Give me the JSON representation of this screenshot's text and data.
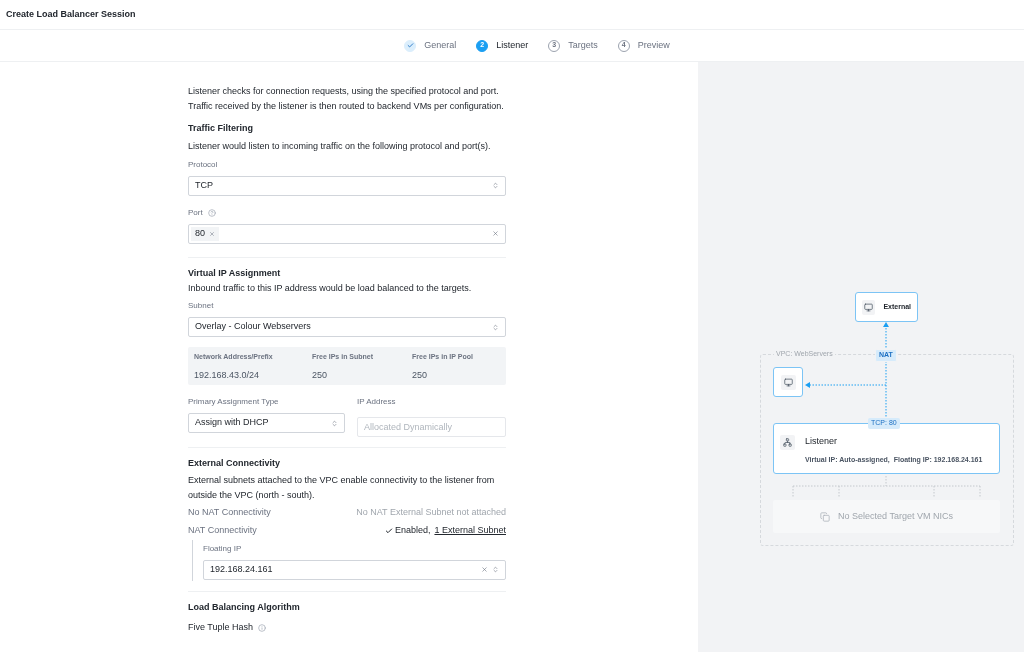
{
  "title": "Create Load Balancer Session",
  "steps": [
    {
      "label": "General",
      "selected": false,
      "completed": true
    },
    {
      "number": "2",
      "label": "Listener",
      "selected": true,
      "completed": false
    },
    {
      "number": "3",
      "label": "Targets",
      "selected": false,
      "completed": false
    },
    {
      "number": "4",
      "label": "Preview",
      "selected": false,
      "completed": false
    }
  ],
  "intro": [
    "Listener checks for connection requests, using the specified protocol and port.",
    "Traffic received by the listener is then routed to backend VMs per configuration."
  ],
  "traffic_filtering": {
    "heading": "Traffic Filtering",
    "description": "Listener would listen to incoming traffic on the following protocol and port(s).",
    "protocol": {
      "label": "Protocol",
      "value": "TCP"
    },
    "port": {
      "label": "Port",
      "tags": [
        "80"
      ]
    }
  },
  "virtual_ip": {
    "heading": "Virtual IP Assignment",
    "description": "Inbound traffic to this IP address would be load balanced to the targets.",
    "subnet": {
      "label": "Subnet",
      "value": "Overlay - Colour Webservers"
    },
    "info": [
      {
        "label": "Network Address/Prefix",
        "value": "192.168.43.0/24"
      },
      {
        "label": "Free IPs in Subnet",
        "value": "250"
      },
      {
        "label": "Free IPs in IP Pool",
        "value": "250"
      }
    ],
    "assignment_type": {
      "label": "Primary Assignment Type",
      "value": "Assign with DHCP"
    },
    "ip_address": {
      "label": "IP Address",
      "placeholder": "Allocated Dynamically"
    }
  },
  "external_connectivity": {
    "heading": "External Connectivity",
    "description": "External subnets attached to the VPC enable connectivity to the listener from outside the VPC (north - south).",
    "rows": [
      {
        "label": "No NAT Connectivity",
        "value": "No NAT External Subnet not attached",
        "enabled": false
      },
      {
        "label": "NAT Connectivity",
        "value": "Enabled,",
        "link": "1 External Subnet",
        "enabled": true
      }
    ],
    "floating_ip": {
      "label": "Floating IP",
      "value": "192.168.24.161"
    }
  },
  "load_balancing": {
    "heading": "Load Balancing Algorithm",
    "algorithm": "Five Tuple Hash"
  },
  "diagram": {
    "external": "External",
    "vpc": "VPC: WebServers",
    "nat": "NAT",
    "port_label": "TCP: 80",
    "listener": {
      "title": "Listener",
      "detail": "Virtual IP: Auto-assigned,  Floating IP: 192.168.24.161"
    },
    "targets": "No Selected Target VM NICs"
  }
}
